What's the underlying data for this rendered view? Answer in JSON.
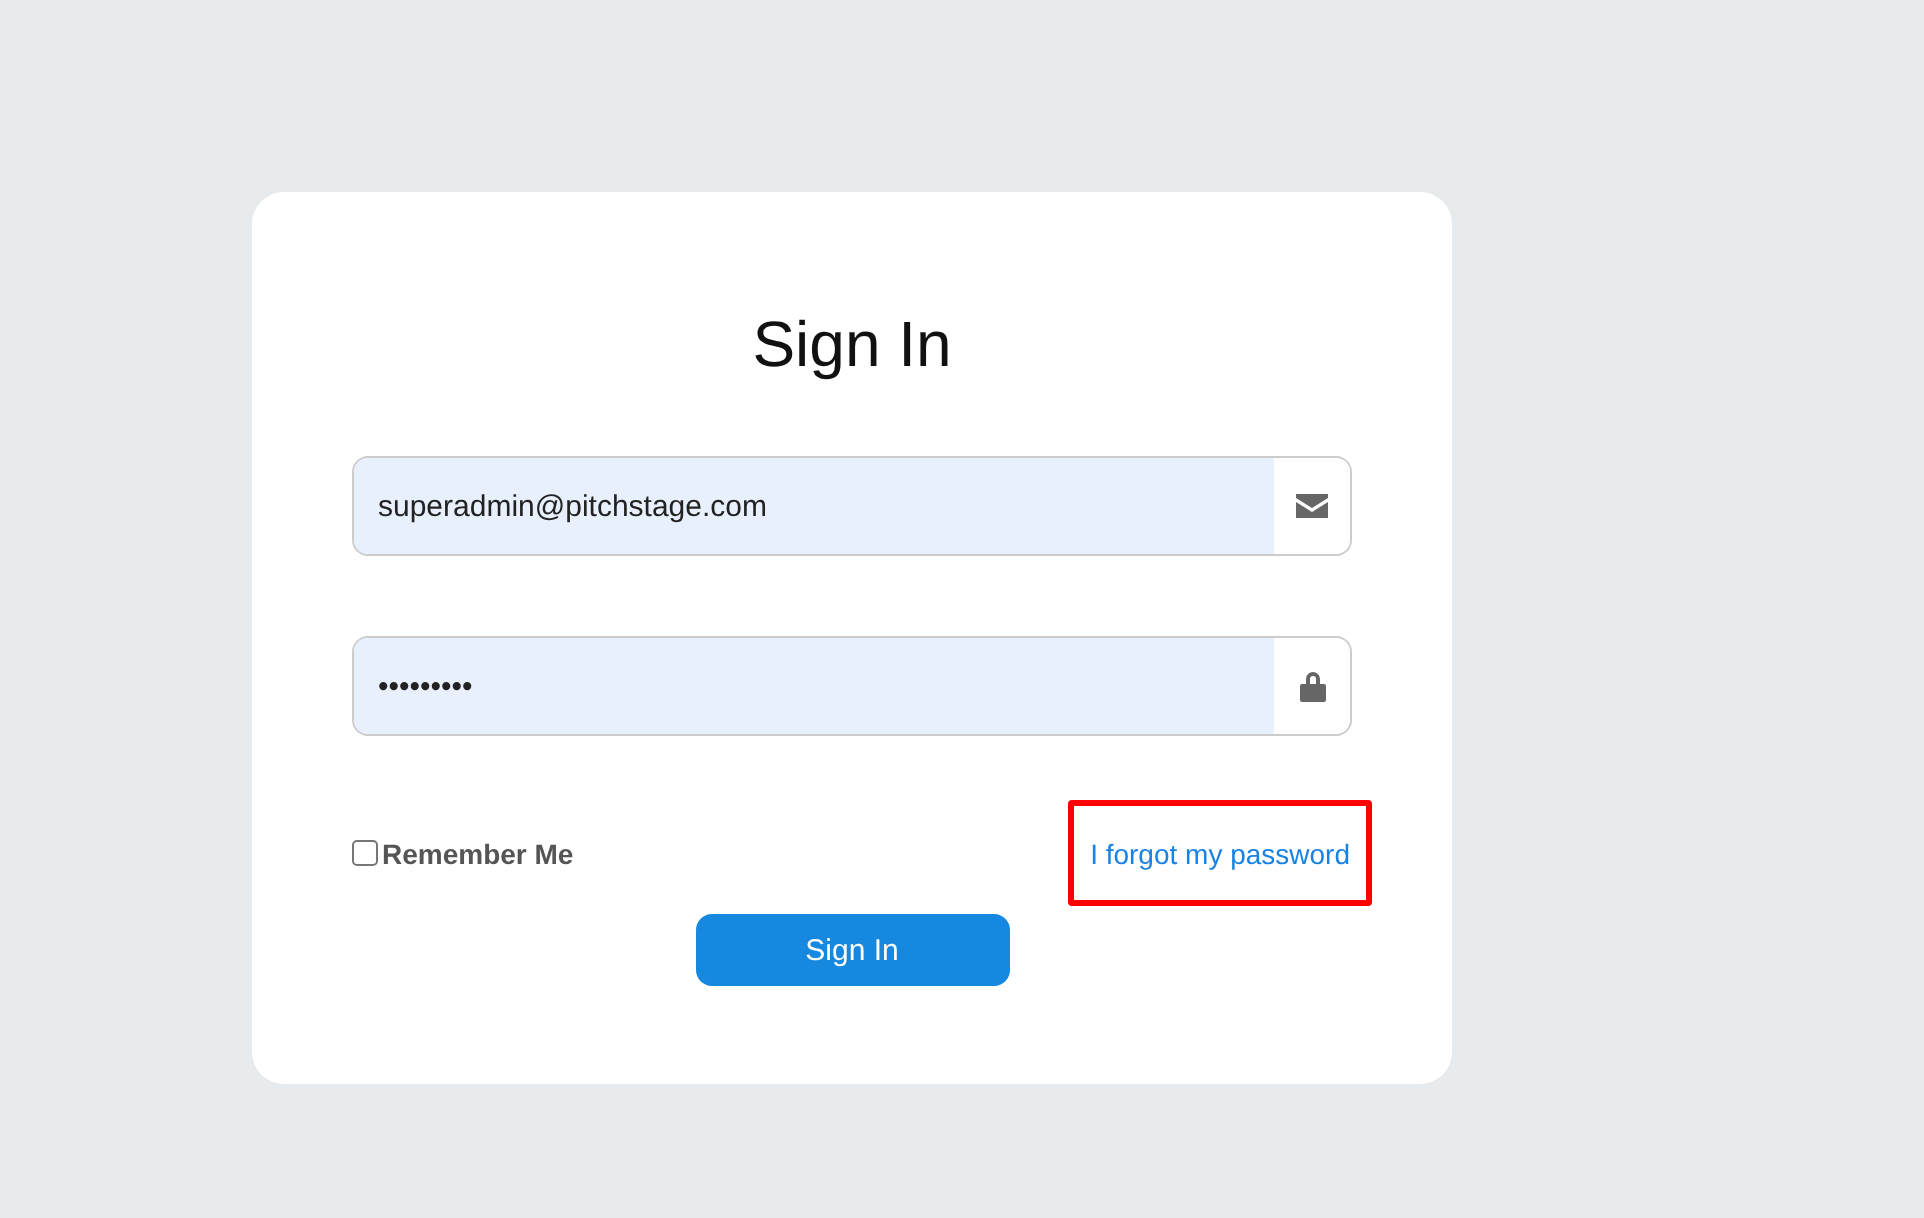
{
  "title": "Sign In",
  "fields": [
    {
      "kind": "email",
      "value": "superadmin@pitchstage.com"
    },
    {
      "kind": "password",
      "value": "•••••••••"
    }
  ],
  "remember": {
    "label": "Remember Me",
    "checked": false
  },
  "forgot_link": {
    "label": "I forgot my password",
    "highlighted": true
  },
  "submit": {
    "label": "Sign In"
  }
}
